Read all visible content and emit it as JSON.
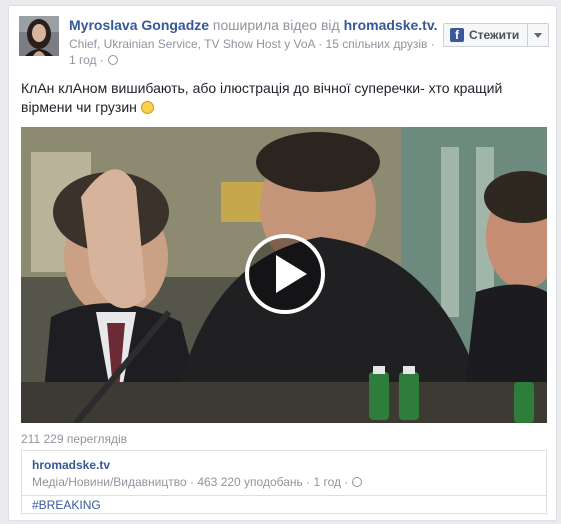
{
  "post": {
    "author": "Myroslava Gongadze",
    "shared_text": " поширила відео від ",
    "page_name": "hromadske.tv.",
    "author_subtitle": "Chief, Ukrainian Service, TV Show Host у VoA · 15 спільних друзів ·",
    "time": "1 год ·",
    "text": "КлАн клАном вишибають, або ілюстрація до вічної суперечки- хто кращий вірмени чи грузин "
  },
  "follow": {
    "icon_letter": "f",
    "label": "Стежити"
  },
  "video": {
    "views": "211 229 переглядів"
  },
  "attachment": {
    "page": "hromadske.tv",
    "meta": "Медіа/Новини/Видавництво · 463 220 уподобань · 1 год ·",
    "hashtag": "#BREAKING"
  },
  "colors": {
    "link": "#365899",
    "muted": "#90949c",
    "facebook_blue": "#3b5998"
  }
}
